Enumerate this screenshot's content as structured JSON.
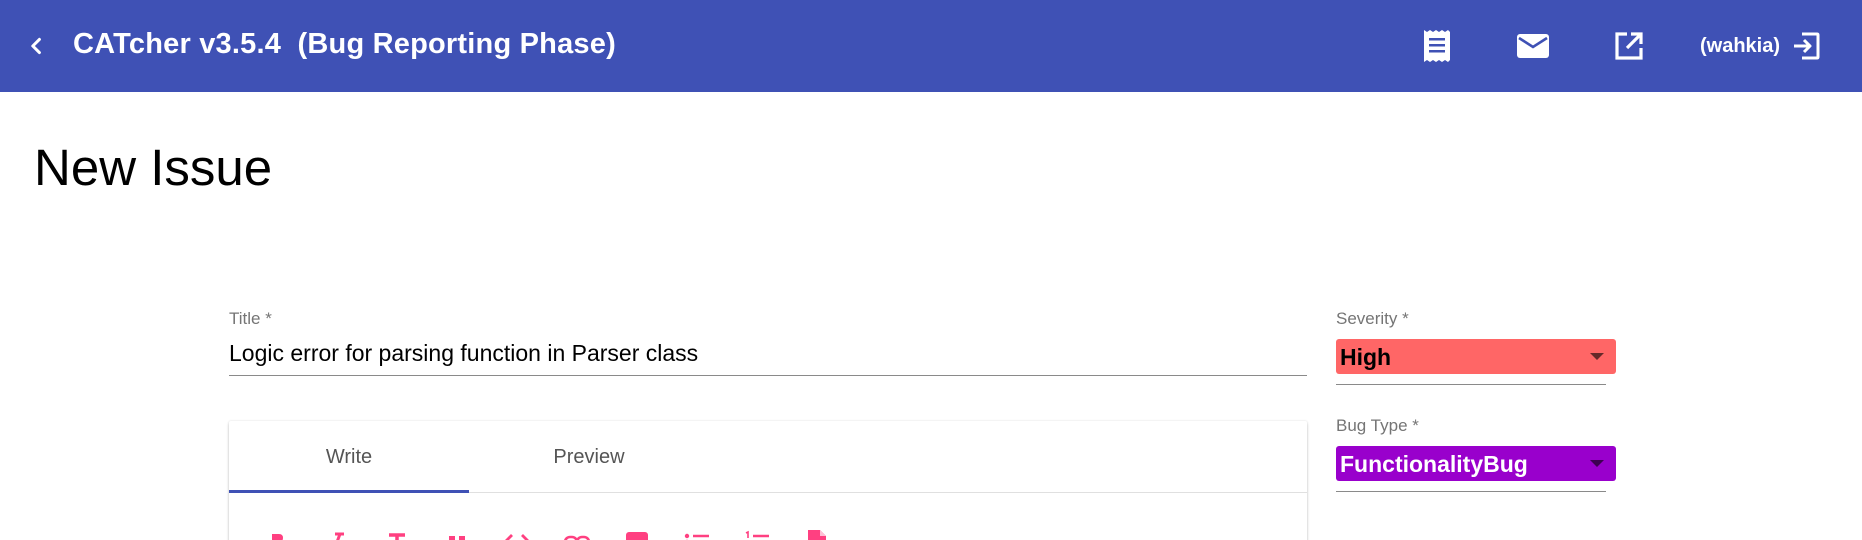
{
  "toolbar": {
    "app_title": "CATcher v3.5.4  (Bug Reporting Phase)",
    "username": "(wahkia)",
    "icons": [
      "back-arrow-icon",
      "receipt-icon",
      "mail-icon",
      "open-in-new-icon",
      "logout-icon"
    ],
    "background_color": "#3f51b5"
  },
  "page": {
    "title": "New Issue"
  },
  "form": {
    "title_label": "Title *",
    "title_value": "Logic error for parsing function in Parser class",
    "severity_label": "Severity *",
    "severity_value": "High",
    "severity_color": "#ff6666",
    "bug_type_label": "Bug Type *",
    "bug_type_value": "FunctionalityBug",
    "bug_type_color": "#9900cc"
  },
  "editor": {
    "tabs": [
      {
        "label": "Write",
        "active": true
      },
      {
        "label": "Preview",
        "active": false
      }
    ],
    "format_buttons": [
      "bold-icon",
      "italic-icon",
      "heading-icon",
      "quote-icon",
      "code-icon",
      "link-icon",
      "image-icon",
      "bulleted-list-icon",
      "numbered-list-icon",
      "file-icon"
    ],
    "accent_color": "#ff4081"
  }
}
